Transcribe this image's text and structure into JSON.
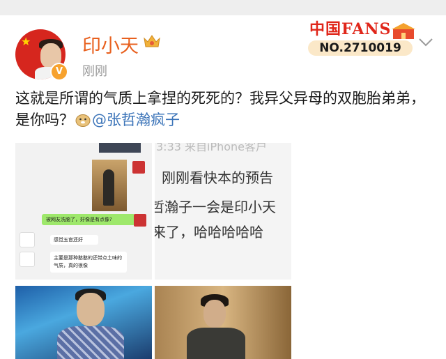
{
  "user": {
    "name": "印小天",
    "timestamp": "刚刚",
    "verified_badge": "V"
  },
  "fans_badge": {
    "logo_text": "中国FANS",
    "number": "NO.2710019"
  },
  "post": {
    "text": "这就是所谓的气质上拿捏的死死的？我异父异母的双胞胎弟弟，是你吗？",
    "mention": "@张哲瀚疯子"
  },
  "images": {
    "chat": {
      "green_bubble": "被网友洗脑了，好像是有点像?",
      "reply_1": "感觉五官还好",
      "reply_2": "主要是那种憨憨的还带点土味的气质，真的很像"
    },
    "screen": {
      "line_0": "3:33 来自iPhone客户",
      "line_1": "刚刚看快本的预告",
      "line_2": "哲瀚子一会是印小天",
      "line_3": "来了，哈哈哈哈哈"
    }
  },
  "colors": {
    "username": "#e8601e",
    "mention": "#3a73b8",
    "timestamp": "#9a9a9a"
  },
  "icons": {
    "crown": "crown-icon",
    "chevron": "chevron-down-icon",
    "emoji": "doge-emoji-icon",
    "verified": "verified-v-icon"
  }
}
